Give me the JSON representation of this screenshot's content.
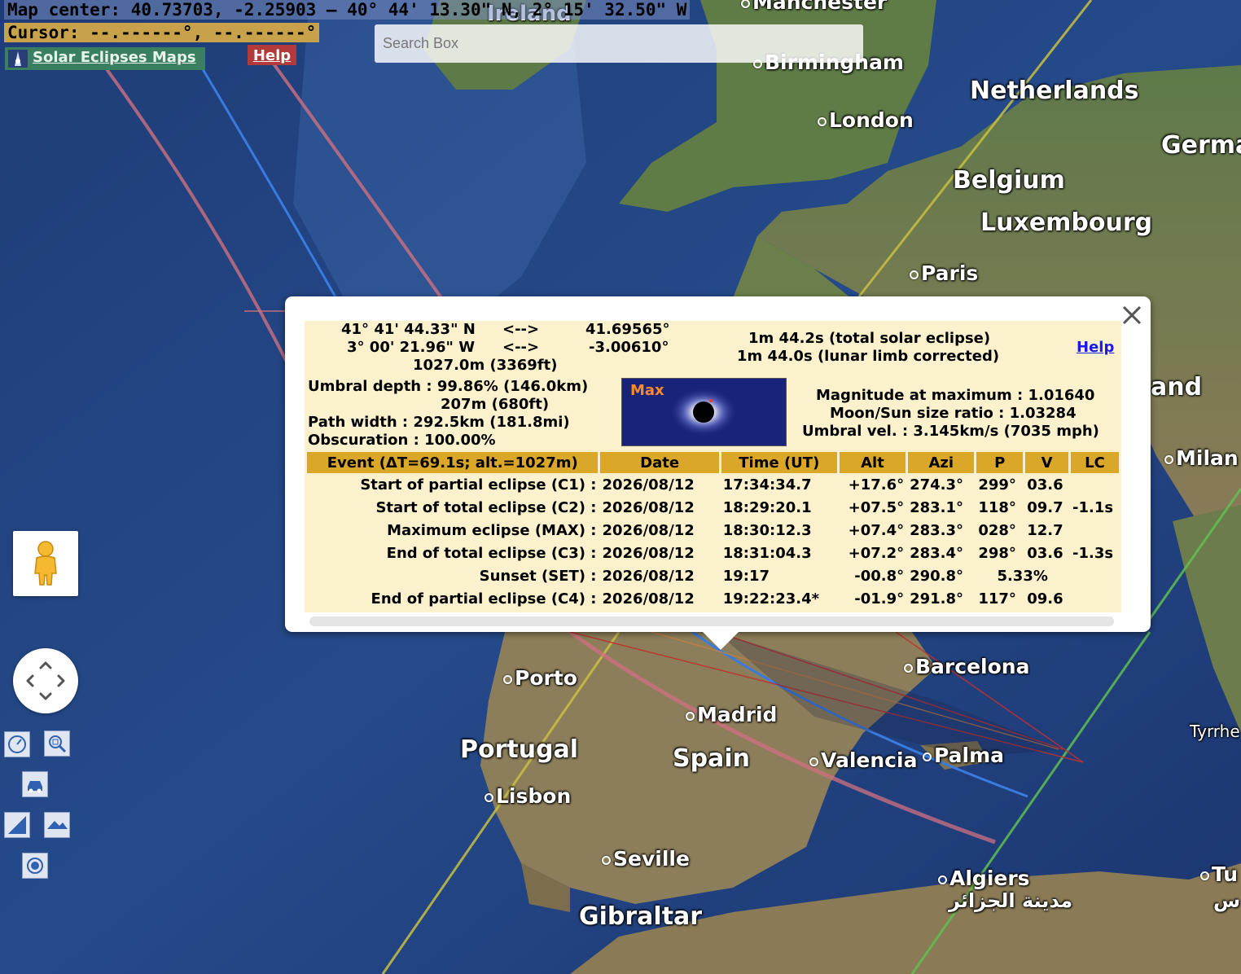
{
  "header": {
    "map_center": "Map center: 40.73703, -2.25903 — 40° 44' 13.30\" N, 2° 15' 32.50\" W",
    "cursor": "Cursor: --.------°, --.------°",
    "app_link": "Solar Eclipses Maps",
    "help": "Help"
  },
  "search": {
    "placeholder": "Search Box"
  },
  "map": {
    "labels": [
      {
        "id": "ireland",
        "text": "Ireland",
        "type": "country"
      },
      {
        "id": "manchester",
        "text": "Manchester",
        "type": "city"
      },
      {
        "id": "birmingham",
        "text": "Birmingham",
        "type": "city"
      },
      {
        "id": "london",
        "text": "London",
        "type": "city"
      },
      {
        "id": "netherlands",
        "text": "Netherlands",
        "type": "country"
      },
      {
        "id": "germany",
        "text": "Germa",
        "type": "country"
      },
      {
        "id": "belgium",
        "text": "Belgium",
        "type": "country"
      },
      {
        "id": "luxembourg",
        "text": "Luxembourg",
        "type": "country"
      },
      {
        "id": "paris",
        "text": "Paris",
        "type": "city"
      },
      {
        "id": "switzerland",
        "text": "and",
        "type": "country"
      },
      {
        "id": "milan",
        "text": "Milan",
        "type": "city"
      },
      {
        "id": "barcelona",
        "text": "Barcelona",
        "type": "city"
      },
      {
        "id": "porto",
        "text": "Porto",
        "type": "city"
      },
      {
        "id": "madrid",
        "text": "Madrid",
        "type": "city"
      },
      {
        "id": "portugal",
        "text": "Portugal",
        "type": "country"
      },
      {
        "id": "spain",
        "text": "Spain",
        "type": "country"
      },
      {
        "id": "valencia",
        "text": "Valencia",
        "type": "city"
      },
      {
        "id": "palma",
        "text": "Palma",
        "type": "city"
      },
      {
        "id": "tyrrhenian",
        "text": "Tyrrhe",
        "type": "sea"
      },
      {
        "id": "lisbon",
        "text": "Lisbon",
        "type": "city"
      },
      {
        "id": "seville",
        "text": "Seville",
        "type": "city"
      },
      {
        "id": "algiers",
        "text": "Algiers",
        "type": "city"
      },
      {
        "id": "algiers_ar",
        "text": "مدينة الجزائر",
        "type": "city"
      },
      {
        "id": "tunis",
        "text": "Tu",
        "type": "city"
      },
      {
        "id": "tunis_ar",
        "text": "س",
        "type": "city"
      },
      {
        "id": "gibraltar",
        "text": "Gibraltar",
        "type": "country"
      }
    ]
  },
  "popup": {
    "coords": {
      "lat_dms": "41° 41' 44.33\" N",
      "lon_dms": "3° 00' 21.96\" W",
      "arrow": "<-->",
      "lat_dec": "41.69565°",
      "lon_dec": "-3.00610°",
      "elevation": "1027.0m (3369ft)"
    },
    "duration_total": "1m 44.2s (total solar eclipse)",
    "duration_limb": "1m 44.0s (lunar limb corrected)",
    "help": "Help",
    "umbral_depth": "Umbral depth : 99.86% (146.0km)",
    "umbral_depth2": "207m (680ft)",
    "path_width": "Path width : 292.5km (181.8mi)",
    "obscuration": "Obscuration : 100.00%",
    "max_label": "Max",
    "magnitude": "Magnitude at maximum : 1.01640",
    "size_ratio": "Moon/Sun size ratio : 1.03284",
    "umbral_vel": "Umbral vel. : 3.145km/s (7035 mph)",
    "table": {
      "headers": [
        "Event (ΔT=69.1s; alt.=1027m)",
        "Date",
        "Time (UT)",
        "Alt",
        "Azi",
        "P",
        "V",
        "LC"
      ],
      "rows": [
        {
          "event": "Start of partial eclipse (C1) :",
          "date": "2026/08/12",
          "time": "17:34:34.7",
          "alt": "+17.6°",
          "azi": "274.3°",
          "p": "299°",
          "v": "03.6",
          "lc": ""
        },
        {
          "event": "Start of total eclipse (C2) :",
          "date": "2026/08/12",
          "time": "18:29:20.1",
          "alt": "+07.5°",
          "azi": "283.1°",
          "p": "118°",
          "v": "09.7",
          "lc": "-1.1s"
        },
        {
          "event": "Maximum eclipse (MAX) :",
          "date": "2026/08/12",
          "time": "18:30:12.3",
          "alt": "+07.4°",
          "azi": "283.3°",
          "p": "028°",
          "v": "12.7",
          "lc": ""
        },
        {
          "event": "End of total eclipse (C3) :",
          "date": "2026/08/12",
          "time": "18:31:04.3",
          "alt": "+07.2°",
          "azi": "283.4°",
          "p": "298°",
          "v": "03.6",
          "lc": "-1.3s"
        },
        {
          "event": "Sunset (SET) :",
          "date": "2026/08/12",
          "time": "19:17",
          "alt": "-00.8°",
          "azi": "290.8°",
          "p": "5.33%",
          "v": "",
          "lc": ""
        },
        {
          "event": "End of partial eclipse (C4) :",
          "date": "2026/08/12",
          "time": "19:22:23.4*",
          "alt": "-01.9°",
          "azi": "291.8°",
          "p": "117°",
          "v": "09.6",
          "lc": ""
        }
      ]
    }
  },
  "colors": {
    "popup_bg": "#fbf2cd",
    "table_header": "#dba729",
    "help_red": "#b23a3a",
    "cursor_bg": "#c8a24a",
    "path_blue": "#3a7be0",
    "path_red": "#d06070",
    "path_yellow": "#c8c040",
    "path_green": "#60c050"
  },
  "icons": [
    "pegman-icon",
    "pan-arrows-icon",
    "compass-icon",
    "zoom-tool-icon",
    "car-icon",
    "elevation-icon",
    "terrain-icon",
    "locate-icon",
    "close-icon",
    "eclipse-logo-icon"
  ]
}
